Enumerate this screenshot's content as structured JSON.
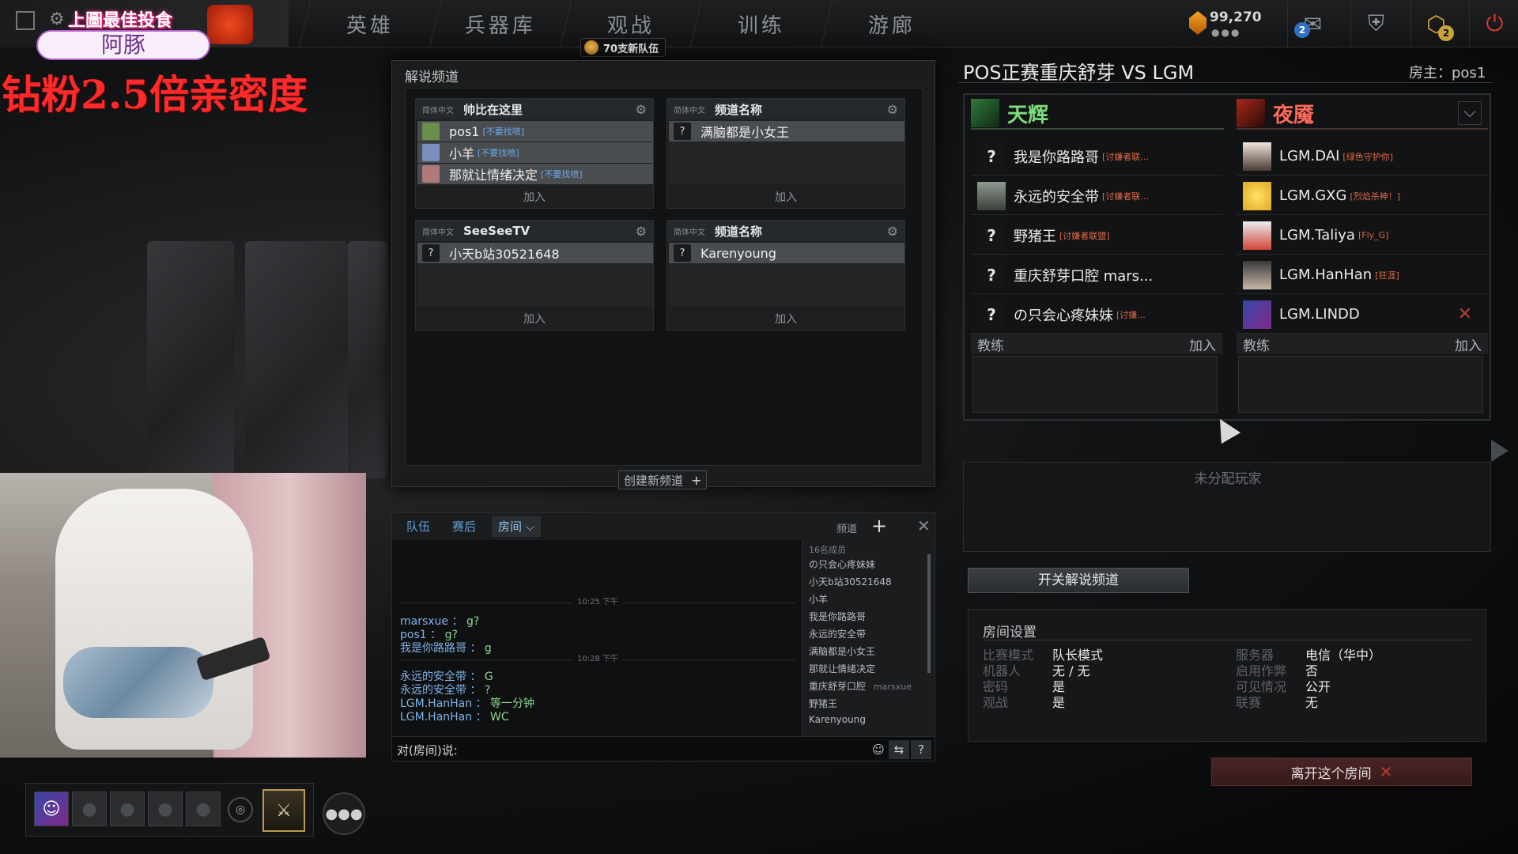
{
  "top_nav": {
    "tabs": [
      "英雄",
      "兵器库",
      "观战",
      "训练",
      "游廊"
    ],
    "currency": "99,270",
    "currency_dots": "●●●",
    "mail_count": "2",
    "plus_count": "2"
  },
  "overlay": {
    "logo_text": "上圖最佳投食",
    "streamer_name": "阿豚",
    "promo_text": "钻粉2.5倍亲密度"
  },
  "badge": {
    "text": "70支新队伍"
  },
  "commentary": {
    "title": "解说频道",
    "channels": [
      {
        "lang": "简体中文",
        "name": "帅比在这里",
        "members": [
          {
            "name": "pos1",
            "tag": "[不要找喷]"
          },
          {
            "name": "小羊",
            "tag": "[不要找喷]"
          },
          {
            "name": "那就让情绪决定",
            "tag": "[不要找喷]"
          }
        ],
        "join": "加入"
      },
      {
        "lang": "简体中文",
        "name": "频道名称",
        "members": [
          {
            "name": "满脑都是小女王",
            "tag": ""
          }
        ],
        "join": "加入"
      },
      {
        "lang": "简体中文",
        "name": "SeeSeeTV",
        "members": [
          {
            "name": "小天b站30521648",
            "tag": ""
          }
        ],
        "join": "加入"
      },
      {
        "lang": "简体中文",
        "name": "频道名称",
        "members": [
          {
            "name": "Karenyoung",
            "tag": ""
          }
        ],
        "join": "加入"
      }
    ],
    "unknown_avatar": "?",
    "new_channel_label": "创建新频道",
    "new_channel_plus": "+"
  },
  "chat": {
    "tabs": {
      "team": "队伍",
      "postgame": "赛后",
      "room": "房间 ⌵"
    },
    "channel_label": "频道",
    "add": "+",
    "close": "✕",
    "timestamps": [
      "10:25 下午",
      "10:28 下午"
    ],
    "messages_a": [
      {
        "who": "marsxue ：",
        "text": "g?"
      },
      {
        "who": "pos1 ：",
        "text": "g?"
      },
      {
        "who": "我是你路路哥 ：",
        "text": "g"
      }
    ],
    "messages_b": [
      {
        "who": "永远的安全带 ：",
        "text": "G"
      },
      {
        "who": "永远的安全带 ：",
        "text": "?"
      },
      {
        "who": "LGM.HanHan ：",
        "text": "等一分钟"
      },
      {
        "who": "LGM.HanHan ：",
        "text": "WC"
      }
    ],
    "member_count": "16名成员",
    "members": [
      {
        "name": "の只会心疼妹妹",
        "sub": ""
      },
      {
        "name": "小天b站30521648",
        "sub": ""
      },
      {
        "name": "小羊",
        "sub": ""
      },
      {
        "name": "我是你路路哥",
        "sub": ""
      },
      {
        "name": "永远的安全带",
        "sub": ""
      },
      {
        "name": "满脑都是小女王",
        "sub": ""
      },
      {
        "name": "那就让情绪决定",
        "sub": ""
      },
      {
        "name": "重庆舒芽口腔",
        "sub": "marsxue"
      },
      {
        "name": "野猪王",
        "sub": ""
      },
      {
        "name": "Karenyoung",
        "sub": ""
      }
    ],
    "input_prompt": "对(房间)说:",
    "icons": [
      "☺",
      "⇆",
      "?"
    ]
  },
  "lobby": {
    "title": "POS正赛重庆舒芽 VS LGM",
    "host": "房主：pos1",
    "radiant": {
      "name": "天辉",
      "players": [
        {
          "name": "我是你路路哥",
          "tag": "[讨嫌者联...",
          "avatar": "?"
        },
        {
          "name": "永远的安全带",
          "tag": "[讨嫌者联...",
          "avatar": ""
        },
        {
          "name": "野猪王",
          "tag": "[讨嫌者联盟]",
          "avatar": "?"
        },
        {
          "name": "重庆舒芽口腔 mars...",
          "tag": "",
          "avatar": "?"
        },
        {
          "name": "の只会心疼妹妹",
          "tag": "[讨嫌...",
          "avatar": "?"
        }
      ],
      "coach_label": "教练",
      "join": "加入"
    },
    "dire": {
      "name": "夜魇",
      "players": [
        {
          "name": "LGM.DAI",
          "tag": "[绿色守护你]"
        },
        {
          "name": "LGM.GXG",
          "tag": "[烈焰杀神！]"
        },
        {
          "name": "LGM.Taliya",
          "tag": "[Fly_G]"
        },
        {
          "name": "LGM.HanHan",
          "tag": "[狂涯]"
        },
        {
          "name": "LGM.LINDD",
          "tag": ""
        }
      ],
      "coach_label": "教练",
      "join": "加入",
      "dropdown": "⌵",
      "kick": "✕"
    },
    "unassigned_label": "未分配玩家",
    "toggle_comm_label": "开关解说频道",
    "leave_label": "离开这个房间",
    "leave_x": "✕"
  },
  "room_settings": {
    "title": "房间设置",
    "left": [
      {
        "key": "比赛模式",
        "value": "队长模式"
      },
      {
        "key": "机器人",
        "value": "无 / 无"
      },
      {
        "key": "密码",
        "value": "是"
      },
      {
        "key": "观战",
        "value": "是"
      }
    ],
    "right": [
      {
        "key": "服务器",
        "value": "电信（华中）"
      },
      {
        "key": "启用作弊",
        "value": "否"
      },
      {
        "key": "可见情况",
        "value": "公开"
      },
      {
        "key": "联赛",
        "value": "无"
      }
    ]
  },
  "colors": {
    "radiant": "#7ee07a",
    "dire": "#ff6a5a",
    "chat_name": "#7fb3e6",
    "chat_text": "#8fd68f",
    "promo": "#ff2a2a"
  }
}
